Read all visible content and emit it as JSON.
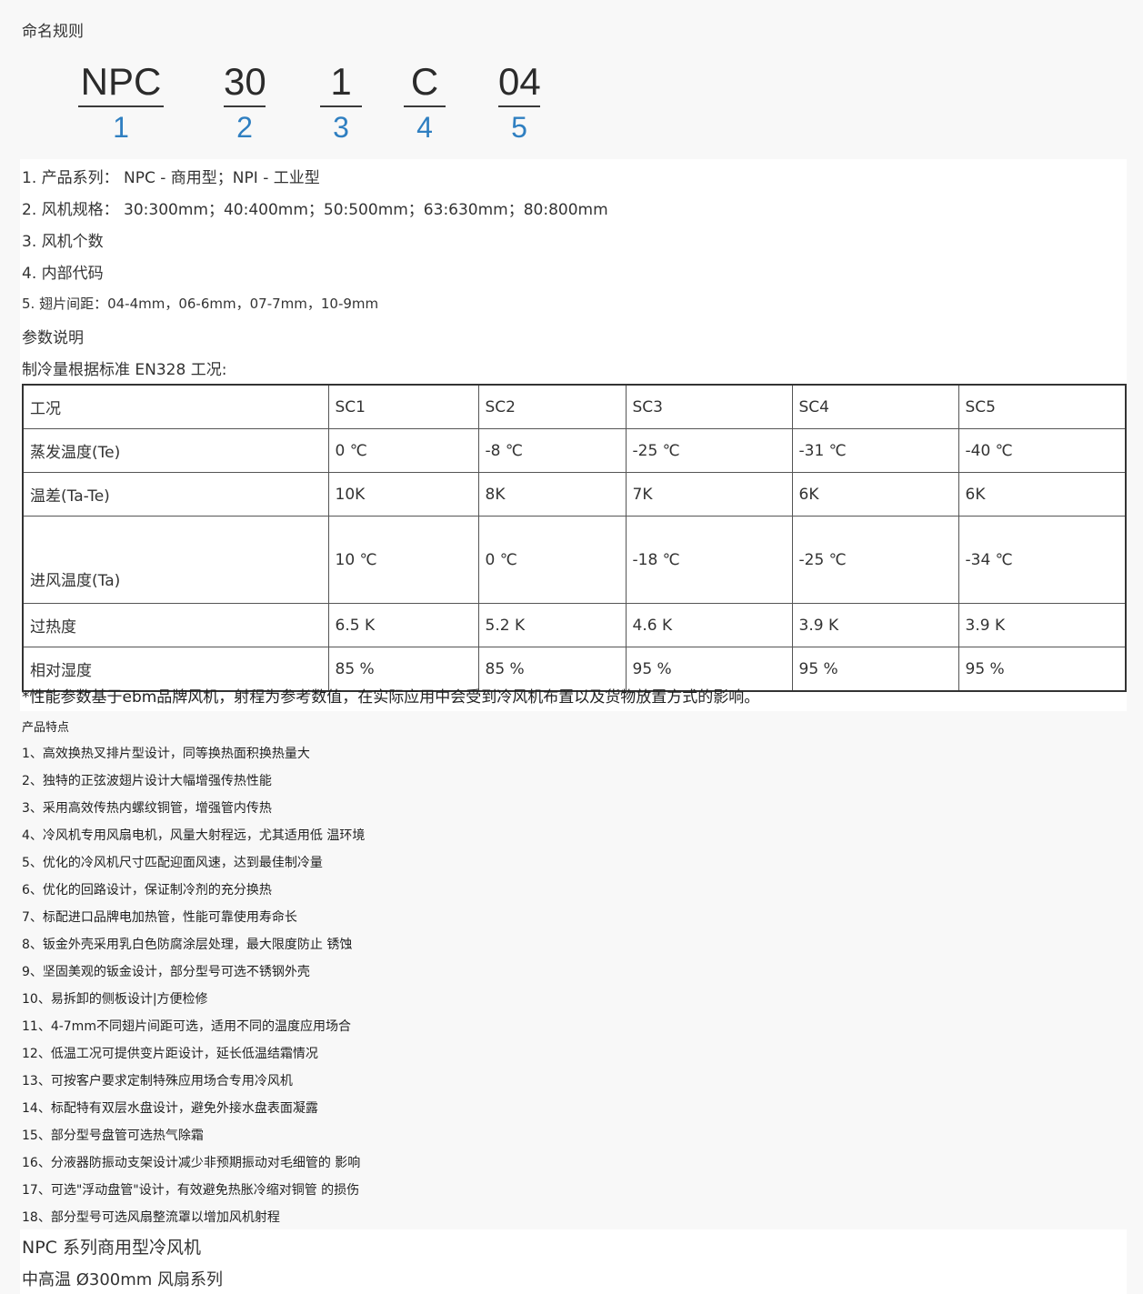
{
  "naming": {
    "title": "命名规则",
    "parts": [
      {
        "code": "NPC",
        "index": "1"
      },
      {
        "code": "30",
        "index": "2"
      },
      {
        "code": "1",
        "index": "3"
      },
      {
        "code": "C",
        "index": "4"
      },
      {
        "code": "04",
        "index": "5"
      }
    ]
  },
  "naming_lines": [
    "1. 产品系列： NPC - 商用型；NPI - 工业型",
    "2. 风机规格： 30:300mm；40:400mm；50:500mm；63:630mm；80:800mm",
    "3. 风机个数",
    "4. 内部代码",
    "5. 翅片间距：04-4mm，06-6mm，07-7mm，10-9mm"
  ],
  "params": {
    "title": "参数说明",
    "subtitle": "制冷量根据标准 EN328 工况:",
    "table": {
      "header": [
        "工况",
        "SC1",
        "SC2",
        "SC3",
        "SC4",
        "SC5"
      ],
      "rows": [
        [
          "蒸发温度(Te)",
          "0 ℃",
          "-8 ℃",
          "-25 ℃",
          "-31 ℃",
          "-40 ℃"
        ],
        [
          "温差(Ta-Te)",
          "10K",
          "8K",
          "7K",
          "6K",
          "6K"
        ],
        [
          "进风温度(Ta)",
          "10 ℃",
          "0 ℃",
          "-18 ℃",
          "-25 ℃",
          "-34 ℃"
        ],
        [
          "过热度",
          "6.5 K",
          "5.2 K",
          "4.6 K",
          "3.9 K",
          "3.9 K"
        ],
        [
          "相对湿度",
          "85 %",
          "85 %",
          "95 %",
          "95 %",
          "95 %"
        ]
      ]
    },
    "note": "*性能参数基于ebm品牌风机，射程为参考数值，在实际应用中会受到冷风机布置以及货物放置方式的影响。"
  },
  "features": {
    "title": "产品特点",
    "items": [
      "1、高效换热叉排片型设计，同等换热面积换热量大",
      "2、独特的正弦波翅片设计大幅增强传热性能",
      "3、采用高效传热内螺纹铜管，增强管内传热",
      "4、冷风机专用风扇电机，风量大射程远，尤其适用低 温环境",
      "5、优化的冷风机尺寸匹配迎面风速，达到最佳制冷量",
      "6、优化的回路设计，保证制冷剂的充分换热",
      "7、标配进口品牌电加热管，性能可靠使用寿命长",
      "8、钣金外壳采用乳白色防腐涂层处理，最大限度防止 锈蚀",
      "9、坚固美观的钣金设计，部分型号可选不锈钢外壳",
      "10、易拆卸的侧板设计|方便检修",
      "11、4-7mm不同翅片间距可选，适用不同的温度应用场合",
      "12、低温工况可提供变片距设计，延长低温结霜情况",
      "13、可按客户要求定制特殊应用场合专用冷风机",
      "14、标配特有双层水盘设计，避免外接水盘表面凝露",
      "15、部分型号盘管可选热气除霜",
      "16、分液器防振动支架设计减少非预期振动对毛细管的 影响",
      "17、可选\"浮动盘管\"设计，有效避免热胀冷缩对铜管 的损伤",
      "18、部分型号可选风扇整流罩以增加风机射程"
    ]
  },
  "series": {
    "title": "NPC 系列商用型冷风机",
    "subtitle": "中高温 Ø300mm 风扇系列"
  }
}
